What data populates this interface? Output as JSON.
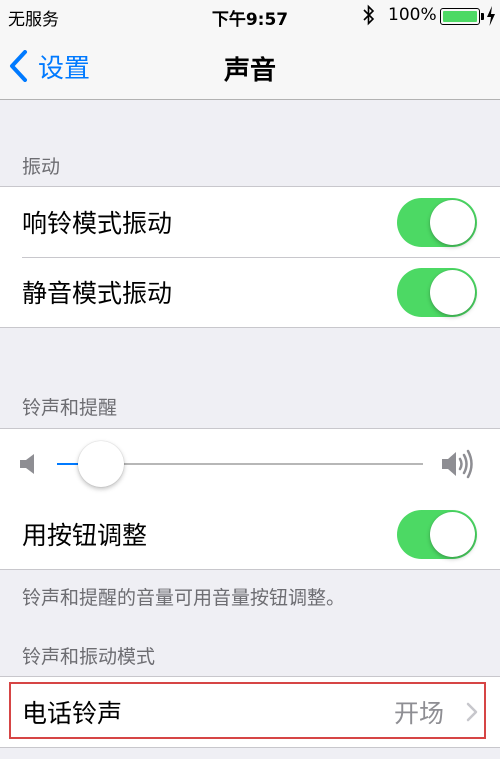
{
  "status_bar": {
    "carrier": "无服务",
    "time": "下午9:57",
    "battery_percent": "100%",
    "battery_level": 1.0,
    "icons": [
      "bluetooth-icon",
      "battery-icon",
      "charging-bolt-icon"
    ],
    "battery_color": "#4cd964"
  },
  "nav": {
    "back_label": "设置",
    "title": "声音",
    "accent_color": "#007aff"
  },
  "sections": {
    "vibrate": {
      "header": "振动",
      "rows": [
        {
          "label": "响铃模式振动",
          "toggle_on": true
        },
        {
          "label": "静音模式振动",
          "toggle_on": true
        }
      ]
    },
    "ringer": {
      "header": "铃声和提醒",
      "volume_level": 0.12,
      "change_with_buttons": {
        "label": "用按钮调整",
        "toggle_on": true
      },
      "footer": "铃声和提醒的音量可用音量按钮调整。"
    },
    "patterns": {
      "header": "铃声和振动模式",
      "rows": [
        {
          "label": "电话铃声",
          "value": "开场"
        }
      ]
    }
  },
  "colors": {
    "toggle_on": "#4cd964",
    "highlight": "#d64545"
  }
}
